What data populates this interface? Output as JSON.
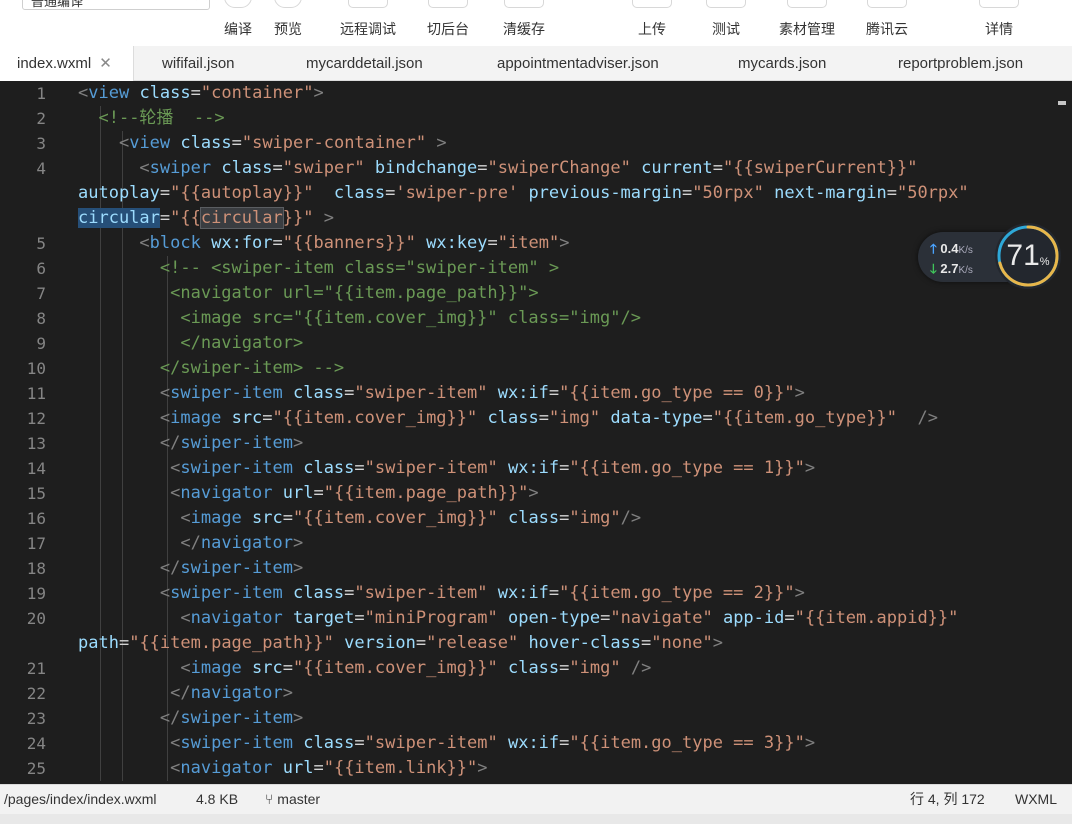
{
  "toolbar": {
    "mode_select": "普通编译",
    "buttons": [
      {
        "label": "编译",
        "icon": "compile-icon"
      },
      {
        "label": "预览",
        "icon": "preview-eye-icon"
      },
      {
        "label": "远程调试",
        "icon": "bug-icon"
      },
      {
        "label": "切后台",
        "icon": "switch-background-icon"
      },
      {
        "label": "清缓存",
        "icon": "layers-icon"
      },
      {
        "label": "上传",
        "icon": "upload-icon"
      },
      {
        "label": "测试",
        "icon": "test-icon"
      },
      {
        "label": "素材管理",
        "icon": "assets-icon"
      },
      {
        "label": "腾讯云",
        "icon": "cloud-icon"
      },
      {
        "label": "详情",
        "icon": "details-icon"
      }
    ]
  },
  "tabs": [
    {
      "label": "index.wxml",
      "active": true,
      "closable": true
    },
    {
      "label": "wififail.json"
    },
    {
      "label": "mycarddetail.json"
    },
    {
      "label": "appointmentadviser.json"
    },
    {
      "label": "mycards.json"
    },
    {
      "label": "reportproblem.json"
    }
  ],
  "editor": {
    "theme_colors": {
      "background": "#1e1e1e",
      "tag": "#569cd6",
      "attribute": "#9cdcfe",
      "string": "#ce9178",
      "comment": "#6a9955",
      "line_number": "#858585"
    },
    "lines": [
      {
        "n": "1",
        "tokens": [
          [
            "p",
            "<"
          ],
          [
            "t",
            "view"
          ],
          [
            "x",
            " "
          ],
          [
            "a",
            "class"
          ],
          [
            "x",
            "="
          ],
          [
            "s",
            "\"container\""
          ],
          [
            "p",
            ">"
          ]
        ]
      },
      {
        "n": "2",
        "tokens": [
          [
            "x",
            "  "
          ],
          [
            "c",
            "<!--轮播  -->"
          ]
        ]
      },
      {
        "n": "3",
        "tokens": [
          [
            "x",
            "    "
          ],
          [
            "p",
            "<"
          ],
          [
            "t",
            "view"
          ],
          [
            "x",
            " "
          ],
          [
            "a",
            "class"
          ],
          [
            "x",
            "="
          ],
          [
            "s",
            "\"swiper-container\""
          ],
          [
            "x",
            " "
          ],
          [
            "p",
            ">"
          ]
        ]
      },
      {
        "n": "4",
        "tokens": [
          [
            "x",
            "      "
          ],
          [
            "p",
            "<"
          ],
          [
            "t",
            "swiper"
          ],
          [
            "x",
            " "
          ],
          [
            "a",
            "class"
          ],
          [
            "x",
            "="
          ],
          [
            "s",
            "\"swiper\""
          ],
          [
            "x",
            " "
          ],
          [
            "a",
            "bindchange"
          ],
          [
            "x",
            "="
          ],
          [
            "s",
            "\"swiperChange\""
          ],
          [
            "x",
            " "
          ],
          [
            "a",
            "current"
          ],
          [
            "x",
            "="
          ],
          [
            "s",
            "\"{{swiperCurrent}}\""
          ]
        ]
      },
      {
        "n": "",
        "tokens": [
          [
            "a",
            "autoplay"
          ],
          [
            "x",
            "="
          ],
          [
            "s",
            "\"{{autoplay}}\""
          ],
          [
            "x",
            "  "
          ],
          [
            "a",
            "class"
          ],
          [
            "x",
            "="
          ],
          [
            "s",
            "'swiper-pre'"
          ],
          [
            "x",
            " "
          ],
          [
            "a",
            "previous-margin"
          ],
          [
            "x",
            "="
          ],
          [
            "s",
            "\"50rpx\""
          ],
          [
            "x",
            " "
          ],
          [
            "a",
            "next-margin"
          ],
          [
            "x",
            "="
          ],
          [
            "s",
            "\"50rpx\""
          ]
        ]
      },
      {
        "n": "",
        "tokens": [
          [
            "a sel",
            "circular"
          ],
          [
            "x",
            "="
          ],
          [
            "s",
            "\"{{"
          ],
          [
            "s hl",
            "circular"
          ],
          [
            "s",
            "}}\""
          ],
          [
            "x",
            " "
          ],
          [
            "p",
            ">"
          ]
        ]
      },
      {
        "n": "5",
        "tokens": [
          [
            "x",
            "      "
          ],
          [
            "p",
            "<"
          ],
          [
            "t",
            "block"
          ],
          [
            "x",
            " "
          ],
          [
            "a",
            "wx:for"
          ],
          [
            "x",
            "="
          ],
          [
            "s",
            "\"{{banners}}\""
          ],
          [
            "x",
            " "
          ],
          [
            "a",
            "wx:key"
          ],
          [
            "x",
            "="
          ],
          [
            "s",
            "\"item\""
          ],
          [
            "p",
            ">"
          ]
        ]
      },
      {
        "n": "6",
        "tokens": [
          [
            "x",
            "        "
          ],
          [
            "c",
            "<!-- <swiper-item class=\"swiper-item\" >"
          ]
        ]
      },
      {
        "n": "7",
        "tokens": [
          [
            "x",
            "         "
          ],
          [
            "c",
            "<navigator url=\"{{item.page_path}}\">"
          ]
        ]
      },
      {
        "n": "8",
        "tokens": [
          [
            "x",
            "          "
          ],
          [
            "c",
            "<image src=\"{{item.cover_img}}\" class=\"img\"/>"
          ]
        ]
      },
      {
        "n": "9",
        "tokens": [
          [
            "x",
            "          "
          ],
          [
            "c",
            "</navigator>"
          ]
        ]
      },
      {
        "n": "10",
        "tokens": [
          [
            "x",
            "        "
          ],
          [
            "c",
            "</swiper-item> -->"
          ]
        ]
      },
      {
        "n": "11",
        "tokens": [
          [
            "x",
            "        "
          ],
          [
            "p",
            "<"
          ],
          [
            "t",
            "swiper-item"
          ],
          [
            "x",
            " "
          ],
          [
            "a",
            "class"
          ],
          [
            "x",
            "="
          ],
          [
            "s",
            "\"swiper-item\""
          ],
          [
            "x",
            " "
          ],
          [
            "a",
            "wx:if"
          ],
          [
            "x",
            "="
          ],
          [
            "s",
            "\"{{item.go_type == 0}}\""
          ],
          [
            "p",
            ">"
          ]
        ]
      },
      {
        "n": "12",
        "tokens": [
          [
            "x",
            "        "
          ],
          [
            "p",
            "<"
          ],
          [
            "t",
            "image"
          ],
          [
            "x",
            " "
          ],
          [
            "a",
            "src"
          ],
          [
            "x",
            "="
          ],
          [
            "s",
            "\"{{item.cover_img}}\""
          ],
          [
            "x",
            " "
          ],
          [
            "a",
            "class"
          ],
          [
            "x",
            "="
          ],
          [
            "s",
            "\"img\""
          ],
          [
            "x",
            " "
          ],
          [
            "a",
            "data-type"
          ],
          [
            "x",
            "="
          ],
          [
            "s",
            "\"{{item.go_type}}\""
          ],
          [
            "x",
            "  "
          ],
          [
            "p",
            "/>"
          ]
        ]
      },
      {
        "n": "13",
        "tokens": [
          [
            "x",
            "        "
          ],
          [
            "p",
            "</"
          ],
          [
            "t",
            "swiper-item"
          ],
          [
            "p",
            ">"
          ]
        ]
      },
      {
        "n": "14",
        "tokens": [
          [
            "x",
            "         "
          ],
          [
            "p",
            "<"
          ],
          [
            "t",
            "swiper-item"
          ],
          [
            "x",
            " "
          ],
          [
            "a",
            "class"
          ],
          [
            "x",
            "="
          ],
          [
            "s",
            "\"swiper-item\""
          ],
          [
            "x",
            " "
          ],
          [
            "a",
            "wx:if"
          ],
          [
            "x",
            "="
          ],
          [
            "s",
            "\"{{item.go_type == 1}}\""
          ],
          [
            "p",
            ">"
          ]
        ]
      },
      {
        "n": "15",
        "tokens": [
          [
            "x",
            "         "
          ],
          [
            "p",
            "<"
          ],
          [
            "t",
            "navigator"
          ],
          [
            "x",
            " "
          ],
          [
            "a",
            "url"
          ],
          [
            "x",
            "="
          ],
          [
            "s",
            "\"{{item.page_path}}\""
          ],
          [
            "p",
            ">"
          ]
        ]
      },
      {
        "n": "16",
        "tokens": [
          [
            "x",
            "          "
          ],
          [
            "p",
            "<"
          ],
          [
            "t",
            "image"
          ],
          [
            "x",
            " "
          ],
          [
            "a",
            "src"
          ],
          [
            "x",
            "="
          ],
          [
            "s",
            "\"{{item.cover_img}}\""
          ],
          [
            "x",
            " "
          ],
          [
            "a",
            "class"
          ],
          [
            "x",
            "="
          ],
          [
            "s",
            "\"img\""
          ],
          [
            "p",
            "/>"
          ]
        ]
      },
      {
        "n": "17",
        "tokens": [
          [
            "x",
            "          "
          ],
          [
            "p",
            "</"
          ],
          [
            "t",
            "navigator"
          ],
          [
            "p",
            ">"
          ]
        ]
      },
      {
        "n": "18",
        "tokens": [
          [
            "x",
            "        "
          ],
          [
            "p",
            "</"
          ],
          [
            "t",
            "swiper-item"
          ],
          [
            "p",
            ">"
          ]
        ]
      },
      {
        "n": "19",
        "tokens": [
          [
            "x",
            "        "
          ],
          [
            "p",
            "<"
          ],
          [
            "t",
            "swiper-item"
          ],
          [
            "x",
            " "
          ],
          [
            "a",
            "class"
          ],
          [
            "x",
            "="
          ],
          [
            "s",
            "\"swiper-item\""
          ],
          [
            "x",
            " "
          ],
          [
            "a",
            "wx:if"
          ],
          [
            "x",
            "="
          ],
          [
            "s",
            "\"{{item.go_type == 2}}\""
          ],
          [
            "p",
            ">"
          ]
        ]
      },
      {
        "n": "20",
        "tokens": [
          [
            "x",
            "          "
          ],
          [
            "p",
            "<"
          ],
          [
            "t",
            "navigator"
          ],
          [
            "x",
            " "
          ],
          [
            "a",
            "target"
          ],
          [
            "x",
            "="
          ],
          [
            "s",
            "\"miniProgram\""
          ],
          [
            "x",
            " "
          ],
          [
            "a",
            "open-type"
          ],
          [
            "x",
            "="
          ],
          [
            "s",
            "\"navigate\""
          ],
          [
            "x",
            " "
          ],
          [
            "a",
            "app-id"
          ],
          [
            "x",
            "="
          ],
          [
            "s",
            "\"{{item.appid}}\""
          ]
        ]
      },
      {
        "n": "",
        "tokens": [
          [
            "a",
            "path"
          ],
          [
            "x",
            "="
          ],
          [
            "s",
            "\"{{item.page_path}}\""
          ],
          [
            "x",
            " "
          ],
          [
            "a",
            "version"
          ],
          [
            "x",
            "="
          ],
          [
            "s",
            "\"release\""
          ],
          [
            "x",
            " "
          ],
          [
            "a",
            "hover-class"
          ],
          [
            "x",
            "="
          ],
          [
            "s",
            "\"none\""
          ],
          [
            "p",
            ">"
          ]
        ]
      },
      {
        "n": "21",
        "tokens": [
          [
            "x",
            "          "
          ],
          [
            "p",
            "<"
          ],
          [
            "t",
            "image"
          ],
          [
            "x",
            " "
          ],
          [
            "a",
            "src"
          ],
          [
            "x",
            "="
          ],
          [
            "s",
            "\"{{item.cover_img}}\""
          ],
          [
            "x",
            " "
          ],
          [
            "a",
            "class"
          ],
          [
            "x",
            "="
          ],
          [
            "s",
            "\"img\""
          ],
          [
            "x",
            " "
          ],
          [
            "p",
            "/>"
          ]
        ]
      },
      {
        "n": "22",
        "tokens": [
          [
            "x",
            "         "
          ],
          [
            "p",
            "</"
          ],
          [
            "t",
            "navigator"
          ],
          [
            "p",
            ">"
          ]
        ]
      },
      {
        "n": "23",
        "tokens": [
          [
            "x",
            "        "
          ],
          [
            "p",
            "</"
          ],
          [
            "t",
            "swiper-item"
          ],
          [
            "p",
            ">"
          ]
        ]
      },
      {
        "n": "24",
        "tokens": [
          [
            "x",
            "         "
          ],
          [
            "p",
            "<"
          ],
          [
            "t",
            "swiper-item"
          ],
          [
            "x",
            " "
          ],
          [
            "a",
            "class"
          ],
          [
            "x",
            "="
          ],
          [
            "s",
            "\"swiper-item\""
          ],
          [
            "x",
            " "
          ],
          [
            "a",
            "wx:if"
          ],
          [
            "x",
            "="
          ],
          [
            "s",
            "\"{{item.go_type == 3}}\""
          ],
          [
            "p",
            ">"
          ]
        ]
      },
      {
        "n": "25",
        "tokens": [
          [
            "x",
            "         "
          ],
          [
            "p",
            "<"
          ],
          [
            "t",
            "navigator"
          ],
          [
            "x",
            " "
          ],
          [
            "a",
            "url"
          ],
          [
            "x",
            "="
          ],
          [
            "s",
            "\"{{item.link}}\""
          ],
          [
            "p",
            ">"
          ]
        ]
      }
    ]
  },
  "speed_widget": {
    "upload": "0.4",
    "download": "2.7",
    "unit": "K/s",
    "percent_value": 71,
    "percent_label": "71",
    "percent_sign": "%",
    "arc_color": "#e8b64a",
    "arc_track": "#2ea8d8"
  },
  "statusbar": {
    "path": "/pages/index/index.wxml",
    "size": "4.8 KB",
    "branch": "master",
    "cursor": "行 4, 列 172",
    "language": "WXML"
  }
}
